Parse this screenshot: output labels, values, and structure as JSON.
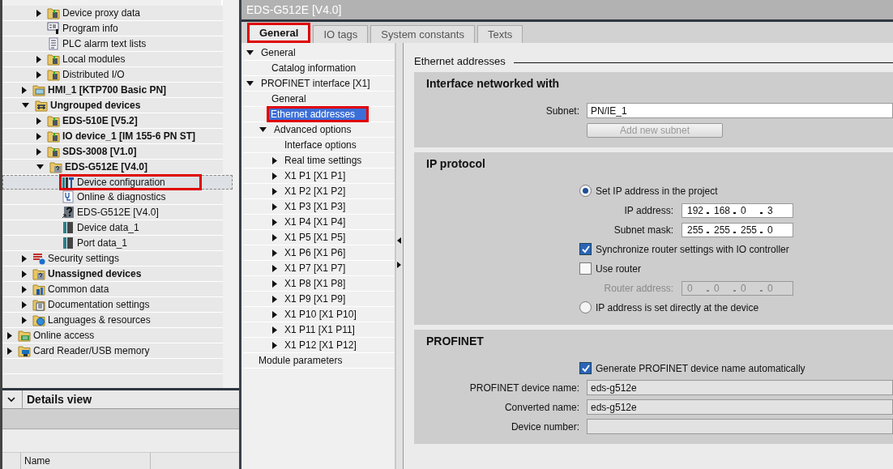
{
  "project_tree": {
    "items": [
      {
        "children": [
          {
            "children": [
              {
                "label": "Device proxy data",
                "kind": "folder-device",
                "bold": false,
                "expanded": false,
                "selected": false,
                "annotated": false
              },
              {
                "label": "Program info",
                "kind": "program-info",
                "bold": false,
                "selected": false,
                "annotated": false
              },
              {
                "label": "PLC alarm text lists",
                "kind": "text-list",
                "bold": false,
                "selected": false,
                "annotated": false
              },
              {
                "label": "Local modules",
                "kind": "folder-device",
                "bold": false,
                "expanded": false,
                "selected": false,
                "annotated": false
              },
              {
                "label": "Distributed I/O",
                "kind": "folder-device",
                "bold": false,
                "expanded": false,
                "selected": false,
                "annotated": false
              }
            ]
          },
          {
            "label": "HMI_1 [KTP700 Basic PN]",
            "kind": "folder-screen",
            "bold": true,
            "expanded": false,
            "selected": false,
            "annotated": false
          },
          {
            "label": "Ungrouped devices",
            "kind": "folder-network",
            "bold": true,
            "expanded": true,
            "selected": false,
            "annotated": false,
            "children": [
              {
                "label": "EDS-510E [V5.2]",
                "kind": "folder-device",
                "bold": true,
                "expanded": false,
                "selected": false,
                "annotated": false
              },
              {
                "label": "IO device_1 [IM 155-6 PN ST]",
                "kind": "folder-device",
                "bold": true,
                "expanded": false,
                "selected": false,
                "annotated": false
              },
              {
                "label": "SDS-3008 [V1.0]",
                "kind": "folder-device",
                "bold": true,
                "expanded": false,
                "selected": false,
                "annotated": false
              },
              {
                "label": "EDS-G512E [V4.0]",
                "kind": "folder-unknown",
                "bold": true,
                "expanded": true,
                "selected": false,
                "annotated": false,
                "children": [
                  {
                    "label": "Device configuration",
                    "kind": "config",
                    "bold": false,
                    "selected": true,
                    "annotated": true
                  },
                  {
                    "label": "Online & diagnostics",
                    "kind": "diagnostics",
                    "bold": false,
                    "selected": false,
                    "annotated": false
                  },
                  {
                    "label": "EDS-G512E [V4.0]",
                    "kind": "device-unknown",
                    "bold": false,
                    "selected": false,
                    "annotated": false
                  },
                  {
                    "label": "Device data_1",
                    "kind": "module",
                    "bold": false,
                    "selected": false,
                    "annotated": false
                  },
                  {
                    "label": "Port data_1",
                    "kind": "module",
                    "bold": false,
                    "selected": false,
                    "annotated": false
                  }
                ]
              }
            ]
          },
          {
            "label": "Security settings",
            "kind": "security",
            "bold": false,
            "expanded": false,
            "selected": false,
            "annotated": false
          },
          {
            "label": "Unassigned devices",
            "kind": "folder-unknown",
            "bold": true,
            "expanded": false,
            "selected": false,
            "annotated": false
          },
          {
            "label": "Common data",
            "kind": "folder-common",
            "bold": false,
            "expanded": false,
            "selected": false,
            "annotated": false
          },
          {
            "label": "Documentation settings",
            "kind": "folder-doc",
            "bold": false,
            "expanded": false,
            "selected": false,
            "annotated": false
          },
          {
            "label": "Languages & resources",
            "kind": "folder-globe",
            "bold": false,
            "expanded": false,
            "selected": false,
            "annotated": false
          }
        ]
      },
      {
        "label": "Online access",
        "kind": "folder-online",
        "bold": false,
        "expanded": false,
        "selected": false,
        "annotated": false
      },
      {
        "label": "Card Reader/USB memory",
        "kind": "folder-card",
        "bold": false,
        "expanded": false,
        "selected": false,
        "annotated": false
      }
    ]
  },
  "details_view": {
    "title": "Details view",
    "columns": [
      "Name"
    ]
  },
  "inspector": {
    "title": "EDS-G512E [V4.0]",
    "tabs": [
      {
        "label": "General",
        "selected": true,
        "annotated": true
      },
      {
        "label": "IO tags",
        "selected": false,
        "annotated": false
      },
      {
        "label": "System constants",
        "selected": false,
        "annotated": false
      },
      {
        "label": "Texts",
        "selected": false,
        "annotated": false
      }
    ],
    "nav": [
      {
        "label": "General",
        "expanded": true,
        "selected": false,
        "annotated": false,
        "children": [
          {
            "label": "Catalog information",
            "selected": false,
            "annotated": false
          }
        ]
      },
      {
        "label": "PROFINET interface [X1]",
        "expanded": true,
        "selected": false,
        "annotated": false,
        "children": [
          {
            "label": "General",
            "selected": false,
            "annotated": false
          },
          {
            "label": "Ethernet addresses",
            "selected": true,
            "annotated": true
          },
          {
            "label": "Advanced options",
            "expanded": true,
            "selected": false,
            "annotated": false,
            "children": [
              {
                "label": "Interface options",
                "selected": false,
                "annotated": false
              },
              {
                "label": "Real time settings",
                "expanded": false,
                "selected": false,
                "annotated": false
              },
              {
                "label": "X1 P1 [X1 P1]",
                "expanded": false,
                "selected": false,
                "annotated": false
              },
              {
                "label": "X1 P2 [X1 P2]",
                "expanded": false,
                "selected": false,
                "annotated": false
              },
              {
                "label": "X1 P3 [X1 P3]",
                "expanded": false,
                "selected": false,
                "annotated": false
              },
              {
                "label": "X1 P4 [X1 P4]",
                "expanded": false,
                "selected": false,
                "annotated": false
              },
              {
                "label": "X1 P5 [X1 P5]",
                "expanded": false,
                "selected": false,
                "annotated": false
              },
              {
                "label": "X1 P6 [X1 P6]",
                "expanded": false,
                "selected": false,
                "annotated": false
              },
              {
                "label": "X1 P7 [X1 P7]",
                "expanded": false,
                "selected": false,
                "annotated": false
              },
              {
                "label": "X1 P8 [X1 P8]",
                "expanded": false,
                "selected": false,
                "annotated": false
              },
              {
                "label": "X1 P9 [X1 P9]",
                "expanded": false,
                "selected": false,
                "annotated": false
              },
              {
                "label": "X1 P10 [X1 P10]",
                "expanded": false,
                "selected": false,
                "annotated": false
              },
              {
                "label": "X1 P11 [X1 P11]",
                "expanded": false,
                "selected": false,
                "annotated": false
              },
              {
                "label": "X1 P12 [X1 P12]",
                "expanded": false,
                "selected": false,
                "annotated": false
              }
            ]
          }
        ]
      },
      {
        "label": "Module parameters",
        "selected": false,
        "annotated": false
      }
    ],
    "page_title": "Ethernet addresses",
    "sections": [
      {
        "title": "Interface networked with",
        "rows": [
          {
            "kind": "field",
            "label": "Subnet:",
            "value": "PN/IE_1",
            "disabled": false
          },
          {
            "kind": "button",
            "label": "Add new subnet",
            "disabled": true
          }
        ]
      },
      {
        "title": "IP protocol",
        "rows": [
          {
            "kind": "radio",
            "label": "Set IP address in the project",
            "selected": true
          },
          {
            "kind": "ip",
            "label": "IP address:",
            "octets": [
              "192",
              "168",
              "0",
              "3"
            ],
            "disabled": false
          },
          {
            "kind": "ip",
            "label": "Subnet mask:",
            "octets": [
              "255",
              "255",
              "255",
              "0"
            ],
            "disabled": false
          },
          {
            "kind": "checkbox",
            "label": "Synchronize router settings with IO controller",
            "checked": true
          },
          {
            "kind": "checkbox",
            "label": "Use router",
            "checked": false
          },
          {
            "kind": "ip",
            "label": "Router address:",
            "octets": [
              "0",
              "0",
              "0",
              "0"
            ],
            "disabled": true
          },
          {
            "kind": "radio",
            "label": "IP address is set directly at the device",
            "selected": false
          }
        ]
      },
      {
        "title": "PROFINET",
        "rows": [
          {
            "kind": "checkbox",
            "label": "Generate PROFINET device name automatically",
            "checked": true
          },
          {
            "kind": "field",
            "label": "PROFINET device name:",
            "value": "eds-g512e",
            "disabled": true
          },
          {
            "kind": "field",
            "label": "Converted name:",
            "value": "eds-g512e",
            "disabled": true
          },
          {
            "kind": "field",
            "label": "Device number:",
            "disabled": true
          }
        ]
      }
    ]
  }
}
